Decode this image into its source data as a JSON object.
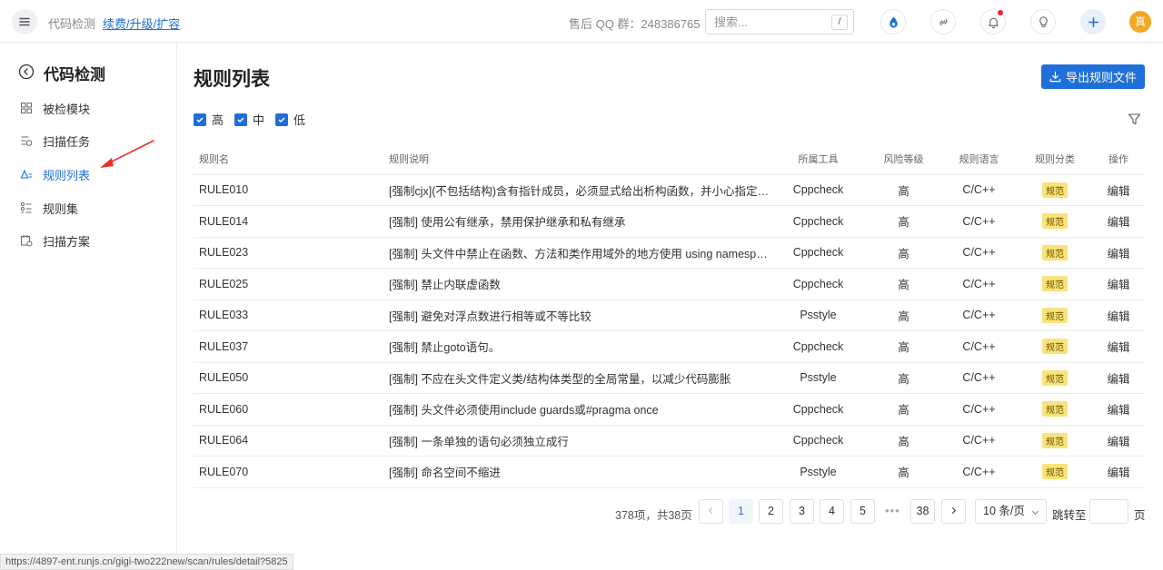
{
  "header": {
    "app_name": "代码检测",
    "renew_link": "续费/升级/扩容",
    "qq_group": "售后 QQ 群：248386765",
    "search_placeholder": "搜索...",
    "search_shortcut": "/",
    "avatar_text": "真"
  },
  "sidebar": {
    "title": "代码检测",
    "items": [
      {
        "label": "被检模块",
        "icon": "grid-icon"
      },
      {
        "label": "扫描任务",
        "icon": "task-icon"
      },
      {
        "label": "规则列表",
        "icon": "rule-icon",
        "active": true
      },
      {
        "label": "规则集",
        "icon": "ruleset-icon"
      },
      {
        "label": "扫描方案",
        "icon": "scheme-icon"
      }
    ]
  },
  "main": {
    "title": "规则列表",
    "export_label": "导出规则文件",
    "filters": [
      {
        "label": "高",
        "checked": true
      },
      {
        "label": "中",
        "checked": true
      },
      {
        "label": "低",
        "checked": true
      }
    ],
    "columns": [
      "规则名",
      "规则说明",
      "所属工具",
      "风险等级",
      "规则语言",
      "规则分类",
      "操作"
    ],
    "rows": [
      {
        "name": "RULE010",
        "desc": "[强制cjx](不包括结构)含有指针成员，必须显式给出析构函数，并小心指定其...",
        "tool": "Cppcheck",
        "level": "高",
        "lang": "C/C++",
        "category": "规范",
        "action": "编辑"
      },
      {
        "name": "RULE014",
        "desc": "[强制] 使用公有继承，禁用保护继承和私有继承",
        "tool": "Cppcheck",
        "level": "高",
        "lang": "C/C++",
        "category": "规范",
        "action": "编辑"
      },
      {
        "name": "RULE023",
        "desc": "[强制] 头文件中禁止在函数、方法和类作用域外的地方使用 using namespace ...",
        "tool": "Cppcheck",
        "level": "高",
        "lang": "C/C++",
        "category": "规范",
        "action": "编辑"
      },
      {
        "name": "RULE025",
        "desc": "[强制] 禁止内联虚函数",
        "tool": "Cppcheck",
        "level": "高",
        "lang": "C/C++",
        "category": "规范",
        "action": "编辑"
      },
      {
        "name": "RULE033",
        "desc": "[强制] 避免对浮点数进行相等或不等比较",
        "tool": "Psstyle",
        "level": "高",
        "lang": "C/C++",
        "category": "规范",
        "action": "编辑"
      },
      {
        "name": "RULE037",
        "desc": "[强制] 禁止goto语句。",
        "tool": "Cppcheck",
        "level": "高",
        "lang": "C/C++",
        "category": "规范",
        "action": "编辑"
      },
      {
        "name": "RULE050",
        "desc": "[强制] 不应在头文件定义类/结构体类型的全局常量，以减少代码膨胀",
        "tool": "Psstyle",
        "level": "高",
        "lang": "C/C++",
        "category": "规范",
        "action": "编辑"
      },
      {
        "name": "RULE060",
        "desc": "[强制] 头文件必须使用include guards或#pragma once",
        "tool": "Cppcheck",
        "level": "高",
        "lang": "C/C++",
        "category": "规范",
        "action": "编辑"
      },
      {
        "name": "RULE064",
        "desc": "[强制] 一条单独的语句必须独立成行",
        "tool": "Cppcheck",
        "level": "高",
        "lang": "C/C++",
        "category": "规范",
        "action": "编辑"
      },
      {
        "name": "RULE070",
        "desc": "[强制] 命名空间不缩进",
        "tool": "Psstyle",
        "level": "高",
        "lang": "C/C++",
        "category": "规范",
        "action": "编辑"
      }
    ]
  },
  "pagination": {
    "total": "378项，共38页",
    "pages": [
      "1",
      "2",
      "3",
      "4",
      "5"
    ],
    "current": "1",
    "dots": "•••",
    "last": "38",
    "page_size": "10 条/页",
    "jump_label": "跳转至",
    "page_suffix": "页"
  },
  "status_url": "https://4897-ent.runjs.cn/gigi-two222new/scan/rules/detail?5825",
  "colors": {
    "accent": "#1e6fd9",
    "tag_bg": "#fbe27a",
    "arrow": "#e8302a"
  }
}
